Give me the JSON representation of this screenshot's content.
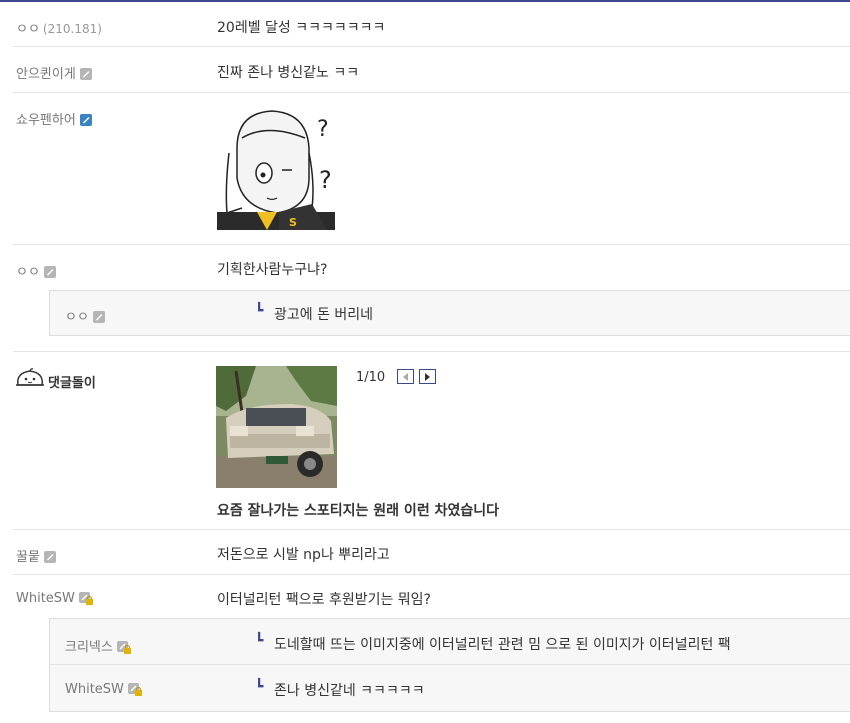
{
  "comments": {
    "c1": {
      "nick": "ㅇㅇ",
      "ip": "(210.181)",
      "text": "20레벨 달성 ㅋㅋㅋㅋㅋㅋㅋ"
    },
    "c2": {
      "nick": "안으퀸이게",
      "text": "진짜 존나 병신같노 ㅋㅋ"
    },
    "c3": {
      "nick": "쇼우펜하어"
    },
    "c4": {
      "nick": "ㅇㅇ",
      "text": "기획한사람누구냐?"
    },
    "c4r": {
      "nick": "ㅇㅇ",
      "text": "광고에 돈 버리네"
    },
    "c5": {
      "nick": "댓글돌이",
      "pager": "1/10",
      "caption": "요즘 잘나가는 스포티지는 원래 이런 차였습니다"
    },
    "c6": {
      "nick": "꿀뭍",
      "text": "저돈으로 시발 np나 뿌리라고"
    },
    "c7": {
      "nick": "WhiteSW",
      "text": "이터널리턴 팩으로 후원받기는 뭐임?"
    },
    "c7r1": {
      "nick": "크리넥스",
      "text": "도네할때 뜨는 이미지중에 이터널리턴 관련 밈 으로 된 이미지가 이터널리턴 팩"
    },
    "c7r2": {
      "nick": "WhiteSW",
      "text": "존나 병신같네 ㅋㅋㅋㅋㅋ"
    }
  },
  "reply_arrow": "┗",
  "icons": {
    "gallery_fixed": "gallery-fixed-icon",
    "gallery_half": "gallery-half-icon",
    "gallery_lock": "gallery-lock-icon",
    "bot": "comment-bot-icon"
  },
  "colors": {
    "accent": "#3b4890",
    "fixed_icon": "#3b82c4",
    "half_icon": "#b5b5b5",
    "lock": "#e0b400"
  }
}
